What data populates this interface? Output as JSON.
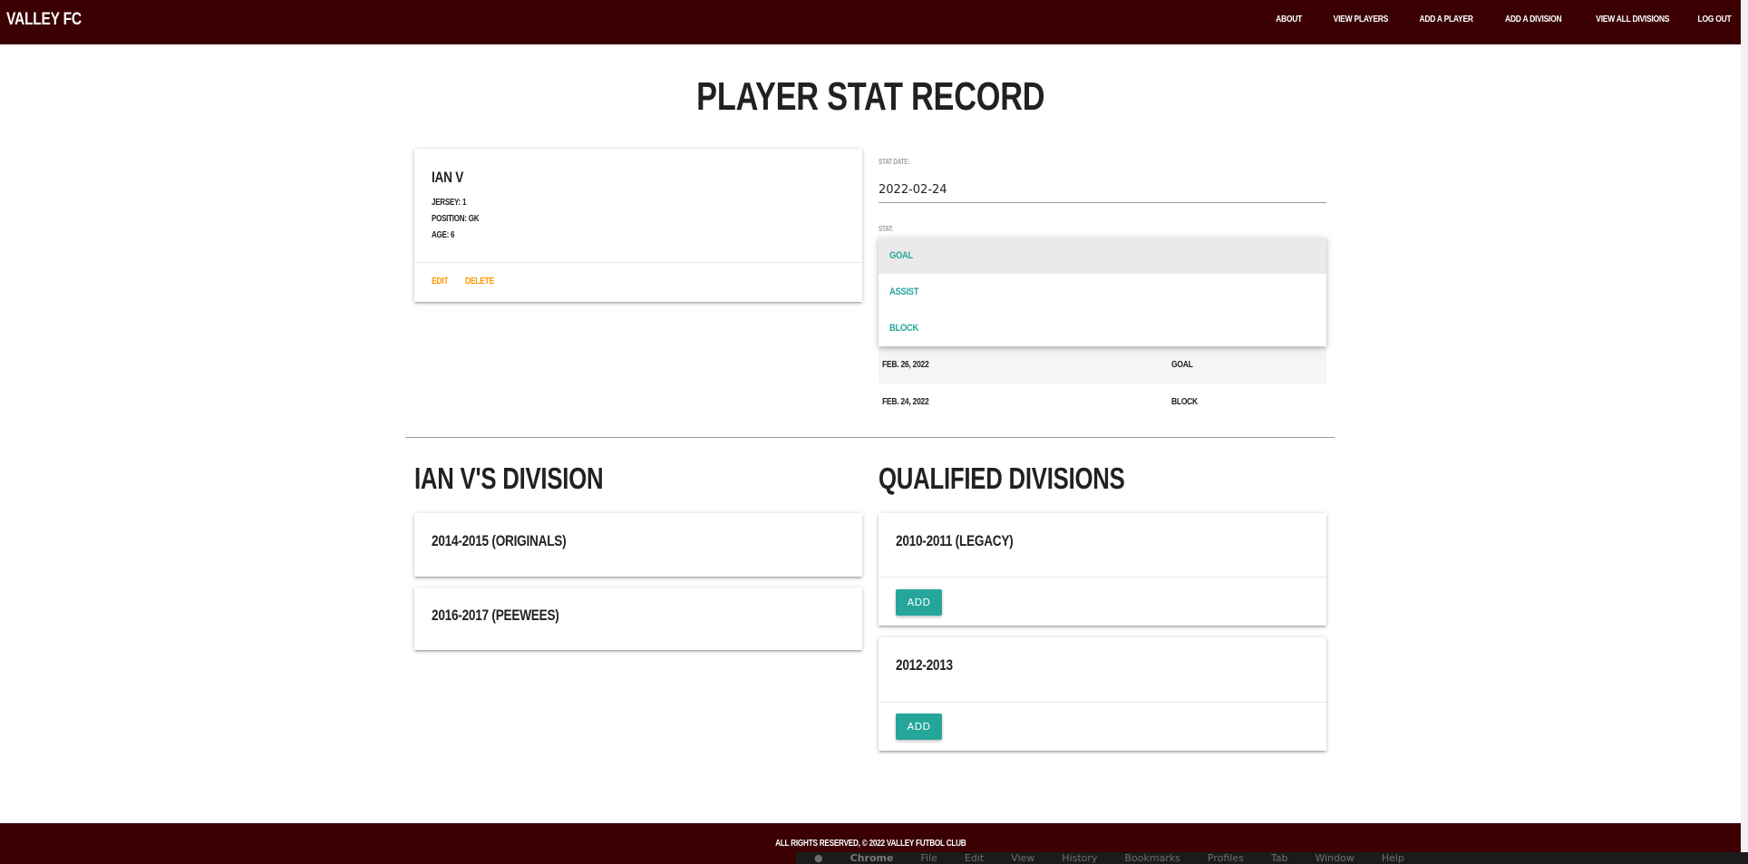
{
  "nav": {
    "brand": "VALLEY FC",
    "links": [
      "ABOUT",
      "VIEW PLAYERS",
      "ADD A PLAYER",
      "ADD A DIVISION",
      "VIEW ALL DIVISIONS",
      "LOG OUT"
    ]
  },
  "page": {
    "title": "PLAYER STAT RECORD"
  },
  "player": {
    "name": "IAN V",
    "jersey": "JERSEY: 1",
    "position": "POSITION: GK",
    "age": "AGE: 6",
    "edit_label": "EDIT",
    "delete_label": "DELETE"
  },
  "form": {
    "date_label": "STAT DATE:",
    "date_value": "2022-02-24",
    "stat_label": "STAT:",
    "stat_options": [
      "GOAL",
      "ASSIST",
      "BLOCK"
    ],
    "highlighted_option": "GOAL"
  },
  "stats": [
    {
      "date": "FEB. 26, 2022",
      "stat": "GOAL"
    },
    {
      "date": "FEB. 24, 2022",
      "stat": "BLOCK"
    }
  ],
  "divisions": {
    "title": "IAN V'S DIVISION",
    "items": [
      "2014-2015 (ORIGINALS)",
      "2016-2017 (PEEWEES)"
    ]
  },
  "qualified": {
    "title": "QUALIFIED DIVISIONS",
    "add_label": "ADD",
    "items": [
      "2010-2011 (LEGACY)",
      "2012-2013"
    ]
  },
  "footer": {
    "text": "ALL RIGHTS RESERVED, © 2022 VALLEY FUTBOL CLUB"
  },
  "os_menu": [
    "",
    "Chrome",
    "File",
    "Edit",
    "View",
    "History",
    "Bookmarks",
    "Profiles",
    "Tab",
    "Window",
    "Help"
  ],
  "colors": {
    "nav_bg": "#3a0002",
    "accent": "#26a69a",
    "action": "#ff9800"
  }
}
